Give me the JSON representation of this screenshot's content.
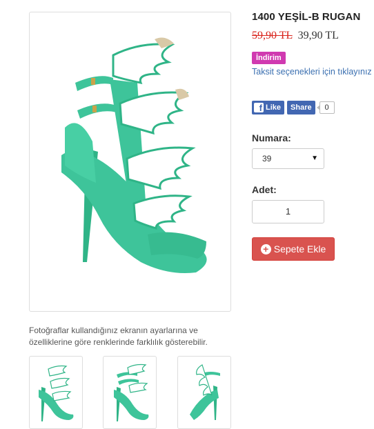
{
  "product": {
    "title": "1400 YEŞİL-B RUGAN",
    "old_price": "59,90 TL",
    "new_price": "39,90 TL",
    "badge": "İndirim",
    "installments_link": "Taksit seçenekleri için tıklayınız"
  },
  "social": {
    "like_label": "Like",
    "share_label": "Share",
    "share_count": "0",
    "like_icon_letter": "f"
  },
  "options": {
    "size_label": "Numara:",
    "size_value": "39",
    "qty_label": "Adet:",
    "qty_value": "1"
  },
  "actions": {
    "add_to_cart": "Sepete Ekle"
  },
  "gallery": {
    "disclaimer": "Fotoğraflar kullandığınız ekranın ayarlarına ve özelliklerine göre renklerinde farklılık gösterebilir."
  },
  "colors": {
    "shoe_green": "#3ec49a",
    "wing_white": "#ffffff",
    "badge": "#d03ab0",
    "button": "#d9534f",
    "facebook": "#4267b2"
  }
}
